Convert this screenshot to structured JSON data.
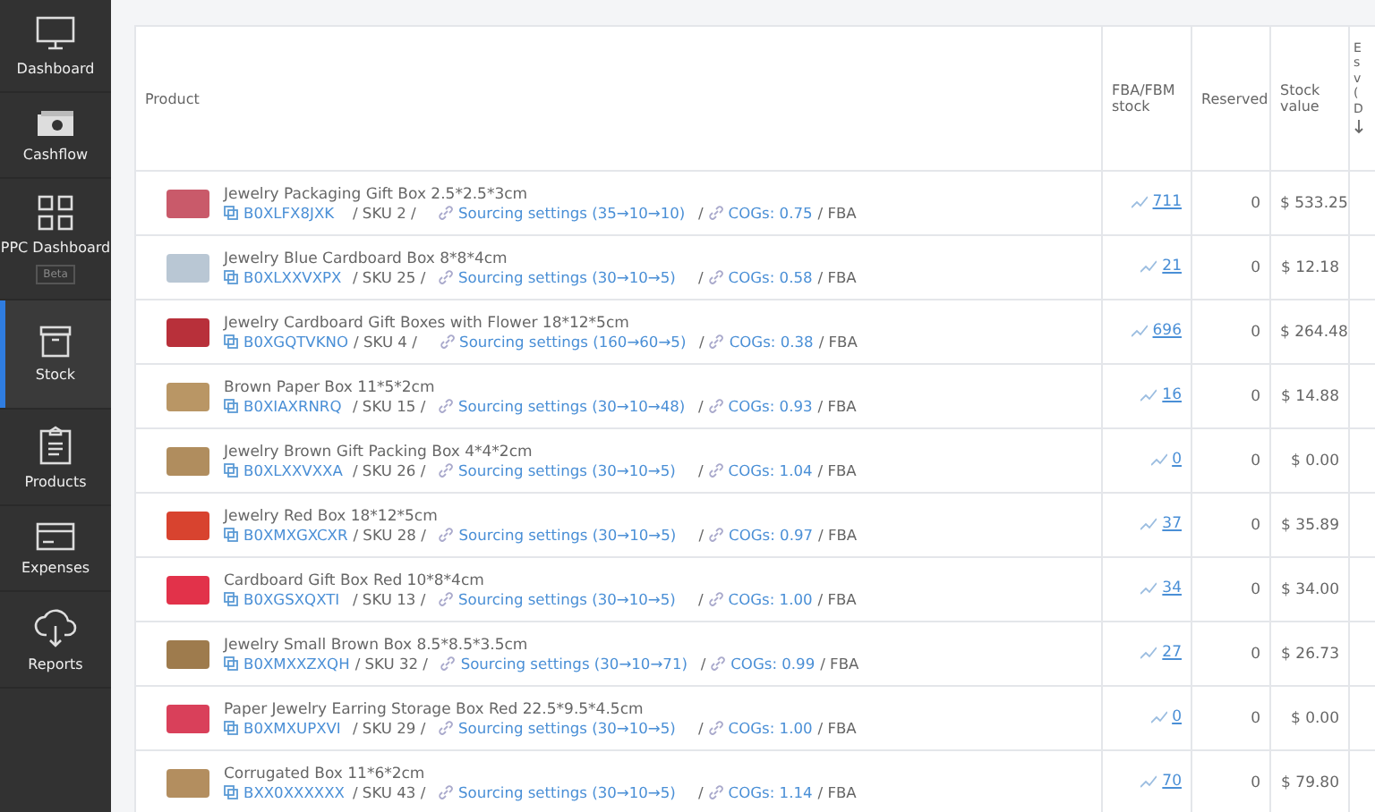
{
  "sidebar": {
    "items": [
      {
        "kind": "monitor",
        "label": "Dashboard",
        "selected": false
      },
      {
        "kind": "cash",
        "label": "Cashflow",
        "selected": false
      },
      {
        "kind": "grid",
        "label": "PPC Dashboard",
        "badge": "Beta",
        "selected": false
      },
      {
        "kind": "box",
        "label": "Stock",
        "selected": true
      },
      {
        "kind": "clipboard",
        "label": "Products",
        "selected": false
      },
      {
        "kind": "card",
        "label": "Expenses",
        "selected": false
      },
      {
        "kind": "cloud",
        "label": "Reports",
        "selected": false
      }
    ]
  },
  "table": {
    "columns": [
      "Product",
      "FBA/FBM stock",
      "Reserved",
      "Stock value",
      "E s v ( D"
    ],
    "rows": [
      {
        "name": "Jewelry Packaging Gift Box 2.5*2.5*3cm",
        "asin": "B0XLFX8JXK",
        "sku": "/ SKU 2 /",
        "sourcing": "Sourcing settings (35→10→10)",
        "sep": "/",
        "cogs": "COGs: 0.75",
        "channel": "/ FBA",
        "stock": "711",
        "reserved": "0",
        "value": "$ 533.25"
      },
      {
        "name": "Jewelry Blue Cardboard Box 8*8*4cm",
        "asin": "B0XLXXVXPX",
        "sku": "/ SKU 25 /",
        "sourcing": "Sourcing settings (30→10→5)",
        "sep": "/",
        "cogs": "COGs: 0.58",
        "channel": "/ FBA",
        "stock": "21",
        "reserved": "0",
        "value": "$ 12.18"
      },
      {
        "name": "Jewelry Cardboard Gift Boxes with Flower 18*12*5cm",
        "asin": "B0XGQTVKNO",
        "sku": "/ SKU 4 /",
        "sourcing": "Sourcing settings (160→60→5)",
        "sep": "/",
        "cogs": "COGs: 0.38",
        "channel": "/ FBA",
        "stock": "696",
        "reserved": "0",
        "value": "$ 264.48"
      },
      {
        "name": "Brown Paper Box 11*5*2cm",
        "asin": "B0XIAXRNRQ",
        "sku": "/ SKU 15 /",
        "sourcing": "Sourcing settings (30→10→48)",
        "sep": "/",
        "cogs": "COGs: 0.93",
        "channel": "/ FBA",
        "stock": "16",
        "reserved": "0",
        "value": "$ 14.88"
      },
      {
        "name": "Jewelry Brown Gift Packing Box 4*4*2cm",
        "asin": "B0XLXXVXXA",
        "sku": "/ SKU 26 /",
        "sourcing": "Sourcing settings (30→10→5)",
        "sep": "/",
        "cogs": "COGs: 1.04",
        "channel": "/ FBA",
        "stock": "0",
        "reserved": "0",
        "value": "$ 0.00"
      },
      {
        "name": "Jewelry Red Box 18*12*5cm",
        "asin": "B0XMXGXCXR",
        "sku": "/ SKU 28 /",
        "sourcing": "Sourcing settings (30→10→5)",
        "sep": "/",
        "cogs": "COGs: 0.97",
        "channel": "/ FBA",
        "stock": "37",
        "reserved": "0",
        "value": "$ 35.89"
      },
      {
        "name": "Cardboard Gift Box Red 10*8*4cm",
        "asin": "B0XGSXQXTI",
        "sku": "/ SKU 13 /",
        "sourcing": "Sourcing settings (30→10→5)",
        "sep": "/",
        "cogs": "COGs: 1.00",
        "channel": "/ FBA",
        "stock": "34",
        "reserved": "0",
        "value": "$ 34.00"
      },
      {
        "name": "Jewelry Small Brown Box 8.5*8.5*3.5cm",
        "asin": "B0XMXXZXQH",
        "sku": "/ SKU 32 /",
        "sourcing": "Sourcing settings (30→10→71)",
        "sep": "/",
        "cogs": "COGs: 0.99",
        "channel": "/ FBA",
        "stock": "27",
        "reserved": "0",
        "value": "$ 26.73"
      },
      {
        "name": "Paper Jewelry Earring Storage Box Red 22.5*9.5*4.5cm",
        "asin": "B0XMXUPXVI",
        "sku": "/ SKU 29 /",
        "sourcing": "Sourcing settings (30→10→5)",
        "sep": "/",
        "cogs": "COGs: 1.00",
        "channel": "/ FBA",
        "stock": "0",
        "reserved": "0",
        "value": "$ 0.00"
      },
      {
        "name": "Corrugated Box 11*6*2cm",
        "asin": "BXX0XXXXXX",
        "sku": "/ SKU 43 /",
        "sourcing": "Sourcing settings (30→10→5)",
        "sep": "/",
        "cogs": "COGs: 1.14",
        "channel": "/ FBA",
        "stock": "70",
        "reserved": "0",
        "value": "$ 79.80"
      }
    ]
  }
}
